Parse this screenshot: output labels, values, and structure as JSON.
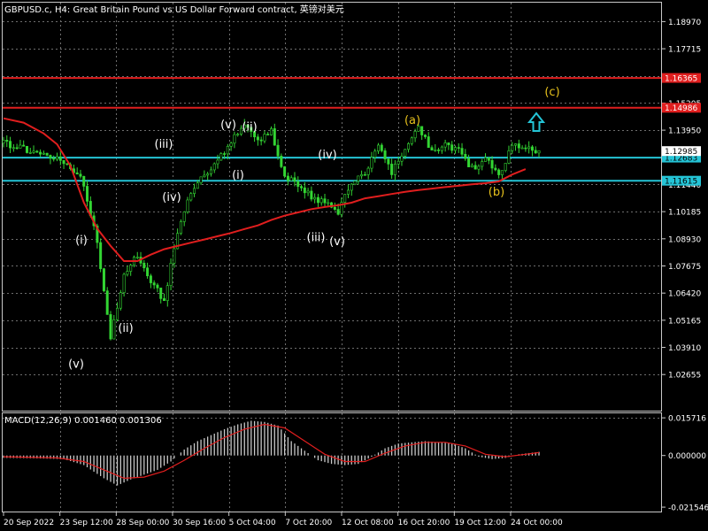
{
  "chart_data": [
    {
      "type": "candlestick",
      "title": "GBPUSD.c, H4:  Great Britain Pound vs US Dollar Forward contract, 英镑对美元",
      "y_ticks": [
        "1.18970",
        "1.17715",
        "1.16460",
        "1.15205",
        "1.13950",
        "1.12695",
        "1.11440",
        "1.10185",
        "1.08930",
        "1.07675",
        "1.06420",
        "1.05165",
        "1.03910",
        "1.02655"
      ],
      "ylim": [
        1.0205,
        1.196
      ],
      "x_ticks": [
        "20 Sep 2022",
        "23 Sep 12:00",
        "28 Sep 00:00",
        "30 Sep 16:00",
        "5 Oct 04:00",
        "7 Oct 20:00",
        "12 Oct 08:00",
        "16 Oct 20:00",
        "19 Oct 12:00",
        "24 Oct 00:00"
      ],
      "price_lines": [
        {
          "label": "1.16365",
          "value": 1.16365,
          "color": "#e01e1e"
        },
        {
          "label": "1.14986",
          "value": 1.14986,
          "color": "#e01e1e"
        },
        {
          "label": "1.12683",
          "value": 1.12683,
          "color": "#24c4d6"
        },
        {
          "label": "1.11615",
          "value": 1.11615,
          "color": "#24c4d6"
        }
      ],
      "current_price": {
        "label": "1.12985",
        "value": 1.12985
      },
      "wave_labels": [
        {
          "text": "(v)",
          "color": "#ffffff"
        },
        {
          "text": "(i)",
          "color": "#ffffff"
        },
        {
          "text": "(ii)",
          "color": "#ffffff"
        },
        {
          "text": "(iii)",
          "color": "#ffffff"
        },
        {
          "text": "(iv)",
          "color": "#ffffff"
        },
        {
          "text": "(v)",
          "color": "#ffffff"
        },
        {
          "text": "(i)",
          "color": "#ffffff"
        },
        {
          "text": "(ii)",
          "color": "#ffffff"
        },
        {
          "text": "(iii)",
          "color": "#ffffff"
        },
        {
          "text": "(iv)",
          "color": "#ffffff"
        },
        {
          "text": "(v)",
          "color": "#ffffff"
        },
        {
          "text": "(a)",
          "color": "#e8c21c"
        },
        {
          "text": "(b)",
          "color": "#e8c21c"
        },
        {
          "text": "(c)",
          "color": "#e8c21c"
        }
      ],
      "wave_anchors": [
        1.0355,
        1.0845,
        1.052,
        1.129,
        1.1125,
        1.138,
        1.1228,
        1.1368,
        1.094,
        1.124,
        1.092,
        1.14,
        1.115,
        1.153
      ],
      "price_key": [
        [
          0,
          1.1335
        ],
        [
          6,
          1.1305
        ],
        [
          12,
          1.128
        ],
        [
          18,
          1.1255
        ],
        [
          24,
          1.115
        ],
        [
          28,
          1.087
        ],
        [
          32,
          1.044
        ],
        [
          36,
          1.072
        ],
        [
          40,
          1.082
        ],
        [
          44,
          1.07
        ],
        [
          48,
          1.06
        ],
        [
          52,
          1.093
        ],
        [
          56,
          1.111
        ],
        [
          60,
          1.119
        ],
        [
          64,
          1.125
        ],
        [
          68,
          1.135
        ],
        [
          72,
          1.143
        ],
        [
          76,
          1.135
        ],
        [
          80,
          1.139
        ],
        [
          84,
          1.118
        ],
        [
          88,
          1.115
        ],
        [
          92,
          1.108
        ],
        [
          96,
          1.106
        ],
        [
          100,
          1.102
        ],
        [
          104,
          1.116
        ],
        [
          108,
          1.12
        ],
        [
          112,
          1.133
        ],
        [
          116,
          1.12
        ],
        [
          120,
          1.13
        ],
        [
          124,
          1.141
        ],
        [
          128,
          1.129
        ],
        [
          132,
          1.133
        ],
        [
          136,
          1.13
        ],
        [
          140,
          1.122
        ],
        [
          144,
          1.126
        ],
        [
          148,
          1.118
        ],
        [
          152,
          1.133
        ],
        [
          156,
          1.131
        ],
        [
          160,
          1.13
        ]
      ],
      "ma": {
        "color": "#e01e1e",
        "points": [
          [
            0,
            1.145
          ],
          [
            6,
            1.143
          ],
          [
            12,
            1.138
          ],
          [
            16,
            1.133
          ],
          [
            20,
            1.123
          ],
          [
            24,
            1.106
          ],
          [
            28,
            1.094
          ],
          [
            32,
            1.086
          ],
          [
            36,
            1.079
          ],
          [
            40,
            1.079
          ],
          [
            44,
            1.082
          ],
          [
            48,
            1.0845
          ],
          [
            52,
            1.086
          ],
          [
            56,
            1.0875
          ],
          [
            60,
            1.089
          ],
          [
            64,
            1.0905
          ],
          [
            68,
            1.092
          ],
          [
            72,
            1.0938
          ],
          [
            76,
            1.0955
          ],
          [
            80,
            1.098
          ],
          [
            84,
            1.1
          ],
          [
            88,
            1.1015
          ],
          [
            92,
            1.103
          ],
          [
            96,
            1.104
          ],
          [
            100,
            1.1048
          ],
          [
            104,
            1.106
          ],
          [
            108,
            1.108
          ],
          [
            112,
            1.109
          ],
          [
            116,
            1.11
          ],
          [
            120,
            1.111
          ],
          [
            124,
            1.1118
          ],
          [
            128,
            1.1125
          ],
          [
            132,
            1.1132
          ],
          [
            136,
            1.1138
          ],
          [
            140,
            1.1145
          ],
          [
            144,
            1.115
          ],
          [
            148,
            1.1158
          ],
          [
            152,
            1.119
          ],
          [
            156,
            1.1215
          ]
        ]
      },
      "bar_count": 161
    },
    {
      "type": "macd",
      "title": "MACD(12,26,9) 0.001460 0.001306",
      "y_ticks": [
        "0.015716",
        "0.000000",
        "-0.021546"
      ],
      "ylim": [
        -0.023,
        0.0165
      ],
      "histogram_key": [
        [
          0,
          -0.001
        ],
        [
          10,
          -0.0012
        ],
        [
          18,
          -0.0015
        ],
        [
          24,
          -0.004
        ],
        [
          30,
          -0.0095
        ],
        [
          34,
          -0.0125
        ],
        [
          38,
          -0.01
        ],
        [
          42,
          -0.008
        ],
        [
          46,
          -0.006
        ],
        [
          50,
          -0.0025
        ],
        [
          54,
          0.0025
        ],
        [
          58,
          0.006
        ],
        [
          62,
          0.0085
        ],
        [
          66,
          0.011
        ],
        [
          70,
          0.013
        ],
        [
          74,
          0.0145
        ],
        [
          78,
          0.014
        ],
        [
          82,
          0.0125
        ],
        [
          86,
          0.006
        ],
        [
          90,
          0.002
        ],
        [
          94,
          -0.002
        ],
        [
          98,
          -0.0035
        ],
        [
          102,
          -0.004
        ],
        [
          106,
          -0.0035
        ],
        [
          110,
          -0.0005
        ],
        [
          114,
          0.003
        ],
        [
          118,
          0.005
        ],
        [
          122,
          0.0055
        ],
        [
          126,
          0.006
        ],
        [
          130,
          0.0055
        ],
        [
          134,
          0.005
        ],
        [
          138,
          0.003
        ],
        [
          142,
          -0.0005
        ],
        [
          146,
          -0.0015
        ],
        [
          150,
          -0.001
        ],
        [
          154,
          0.0005
        ],
        [
          158,
          0.0012
        ],
        [
          160,
          0.0015
        ]
      ],
      "signal_line": {
        "color": "#e01e1e",
        "points": [
          [
            0,
            -0.0005
          ],
          [
            16,
            -0.001
          ],
          [
            24,
            -0.0025
          ],
          [
            30,
            -0.006
          ],
          [
            36,
            -0.0095
          ],
          [
            42,
            -0.009
          ],
          [
            48,
            -0.0065
          ],
          [
            54,
            -0.002
          ],
          [
            60,
            0.003
          ],
          [
            66,
            0.0075
          ],
          [
            72,
            0.011
          ],
          [
            78,
            0.013
          ],
          [
            84,
            0.0115
          ],
          [
            90,
            0.006
          ],
          [
            96,
            0.0005
          ],
          [
            102,
            -0.0025
          ],
          [
            108,
            -0.0025
          ],
          [
            114,
            0.001
          ],
          [
            120,
            0.004
          ],
          [
            126,
            0.0055
          ],
          [
            132,
            0.0055
          ],
          [
            138,
            0.004
          ],
          [
            144,
            0.0005
          ],
          [
            150,
            -0.0005
          ],
          [
            156,
            0.0005
          ],
          [
            160,
            0.0012
          ]
        ]
      }
    }
  ]
}
